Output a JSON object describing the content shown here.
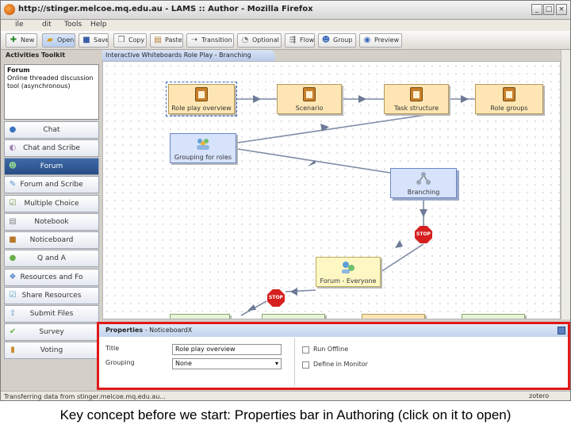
{
  "window": {
    "title": "http://stinger.melcoe.mq.edu.au - LAMS :: Author - Mozilla Firefox",
    "controls": [
      "_",
      "□",
      "×"
    ]
  },
  "menubar": [
    "ile",
    "dit",
    "Tools",
    "Help"
  ],
  "toolbar": [
    {
      "label": "New",
      "icon": "new-icon"
    },
    {
      "label": "Open",
      "icon": "open-icon"
    },
    {
      "label": "Save",
      "icon": "save-icon"
    },
    {
      "label": "Copy",
      "icon": "copy-icon"
    },
    {
      "label": "Paste",
      "icon": "paste-icon"
    },
    {
      "label": "Transition",
      "icon": "transition-icon"
    },
    {
      "label": "Optional",
      "icon": "optional-icon"
    },
    {
      "label": "Flow",
      "icon": "flow-icon"
    },
    {
      "label": "Group",
      "icon": "group-icon"
    },
    {
      "label": "Preview",
      "icon": "preview-icon"
    }
  ],
  "toolkit": {
    "title": "Activities Toolkit",
    "info_title": "Forum",
    "info_text": "Online threaded discussion tool (asynchronous)",
    "items": [
      {
        "label": "Chat",
        "icon": "chat-icon"
      },
      {
        "label": "Chat and Scribe",
        "icon": "chat-scribe-icon"
      },
      {
        "label": "Forum",
        "icon": "forum-icon",
        "selected": true
      },
      {
        "label": "Forum and Scribe",
        "icon": "forum-scribe-icon"
      },
      {
        "label": "Multiple Choice",
        "icon": "multiple-choice-icon"
      },
      {
        "label": "Notebook",
        "icon": "notebook-icon"
      },
      {
        "label": "Noticeboard",
        "icon": "noticeboard-icon"
      },
      {
        "label": "Q and A",
        "icon": "qa-icon"
      },
      {
        "label": "Resources and Fo",
        "icon": "resources-icon"
      },
      {
        "label": "Share Resources",
        "icon": "share-resources-icon"
      },
      {
        "label": "Submit Files",
        "icon": "submit-files-icon"
      },
      {
        "label": "Survey",
        "icon": "survey-icon"
      },
      {
        "label": "Voting",
        "icon": "voting-icon"
      }
    ]
  },
  "canvas": {
    "title": "Interactive Whiteboards Role Play - Branching",
    "activities": {
      "role_play_overview": "Role play overview",
      "scenario": "Scenario",
      "task_structure": "Task structure",
      "role_groups": "Role groups",
      "grouping_for_roles": "Grouping for roles",
      "branching": "Branching",
      "forum_everyone": "Forum - Everyone"
    },
    "stop_label": "STOP"
  },
  "properties": {
    "header_bold": "Properties",
    "header_rest": " - NoticeboardX",
    "title_label": "Title",
    "title_value": "Role play overview",
    "grouping_label": "Grouping",
    "grouping_value": "None",
    "run_offline": "Run Offline",
    "define_in_monitor": "Define in Monitor"
  },
  "status": "Transferring data from stinger.melcoe.mq.edu.au...",
  "zotero": "zotero",
  "caption": "Key concept before we start: Properties bar in Authoring (click on it to open)"
}
